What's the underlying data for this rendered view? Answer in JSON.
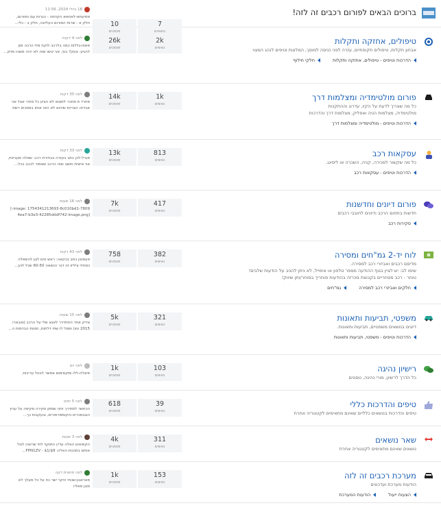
{
  "forums": [
    {
      "id": "welcome",
      "title": "ברוכים הבאים לפורום רכבים זה לזה!",
      "dark": true,
      "icon": "welcome-banner-icon",
      "description": [],
      "links": [],
      "stats": {
        "topics": "7",
        "topics_label": "נושאים",
        "posts": "10",
        "posts_label": "פוסטים"
      },
      "last": {
        "time": "18 ביולי 2024, 11:56",
        "avatar_color": "#c0392b",
        "lines": [
          "פמיעתא-לאתאא הקדמה - הגרות עם הפורום,",
          "חלק א - שרות הפורום העליונה, חלק ב - כלי..."
        ]
      }
    },
    {
      "id": "maintenance",
      "title": "טיפולים, אחזקה ותקלות",
      "icon": "circle-dot-icon",
      "icon_color": "#1a5fb4",
      "description": [
        "אבחון תקלות, טיפולים תקופתיים, עזרה לפני כניסה למוסך, המלצות וטיפים לנהג המצוי"
      ],
      "links": [
        "הדרכות וטיפים - טיפולים, אחזקה ותקלות",
        "חלקי חילוף"
      ],
      "stats": {
        "topics": "2k",
        "topics_label": "נאשים",
        "posts": "26k",
        "posts_label": "פוסטים"
      },
      "last": {
        "time": "לפני 4 דקות",
        "avatar_color": "#2e7d32",
        "lines": [
          "פאוזו-גללות כמה בלרכב לוקח מיזי הרכה זמן",
          "להגיע: צעק? בעי, אני יבשו שזה לא יהיה משהו מזיק..."
        ]
      }
    },
    {
      "id": "multimedia",
      "title": "פורום מולטימדיה ומצלמות דרך",
      "icon": "car-front-icon",
      "icon_color": "#1a1a1a",
      "description": [
        "כל מה שצריך לדעת על הקיו, עדרוג וההתקנות",
        "מולטימדיה, מצלמות הניה ואפליק, מצלמות דרך והדרכות"
      ],
      "links": [
        "הדרכות וטיפים - מולטימדיה ומצלמות דרך"
      ],
      "stats": {
        "topics": "1k",
        "topics_label": "נאשים",
        "posts": "14k",
        "posts_label": "פוסטים"
      },
      "last": {
        "time": "לפני 35 דקות",
        "avatar_color": "#7d7d7d",
        "lines": [
          "פחרד פ מחכר למצוא לא הציע כל מחיר אצל אני",
          "אבדזה הצריות שיהוא לא הזה אותו במסכים רשת"
        ]
      }
    },
    {
      "id": "deals",
      "title": "עסקאות רכב",
      "icon": "car-dealer-icon",
      "icon_color": "#3f51b5",
      "description": [
        "כל מה שקשור למכירה, קניה, השכרה או ליסינג."
      ],
      "links": [
        "הדרכות וטיפים - עסקאות רכב"
      ],
      "stats": {
        "topics": "813",
        "topics_label": "נאשים",
        "posts": "13k",
        "posts_label": "פוסטים"
      },
      "last": {
        "time": "לפני 33 דקות",
        "avatar_color": "#26a69a",
        "lines": [
          "פגרל-לכן כתב בעזרה בבחירת רכב: שאלה מעניינת,",
          "אני אישית חושב שזה הרכב שאמור לבכב בכל..."
        ]
      }
    },
    {
      "id": "discussions",
      "title": "פורום דיונים וחדשנות",
      "icon": "chat-bubbles-icon",
      "icon_color": "#4a3ab8",
      "description": [
        "חדשות בתחום הרכב ודיונים לחובבי רכבים"
      ],
      "links": [
        "סקירות רכב"
      ],
      "stats": {
        "topics": "417",
        "topics_label": "נאשים",
        "posts": "7k",
        "posts_label": "פוסטים"
      },
      "last": {
        "time": "לפני 16 שעות",
        "avatar_color": "#7d7d7d",
        "lines": [
          "image: 1754341213693-8c010bd1-7809-]",
          "[4ea7-b3e3-42285dddf742-image.png"
        ]
      }
    },
    {
      "id": "marketplace",
      "title": "לוח יד-2 גמ\"חים ומסירה",
      "icon": "money-icon",
      "icon_color": "#7cb342",
      "description": [
        "מדיסם רכבים ואביזרי רכב למסירה.",
        "שימו לב: יש לציין בגוף ההודעה מספר טלפון או אימייל, לא ניתן להגיב על הודעות שלבים!",
        "טוחר - רכב מסחריים בקבוצת מכרזה בהודעות סוחריך בסוחר/ותן שיווק!"
      ],
      "links": [
        "חלקים ואביזרי רכב למסירה",
        "גמ\"חים"
      ],
      "stats": {
        "topics": "382",
        "topics_label": "נאשים",
        "posts": "758",
        "posts_label": "פוסטים"
      },
      "last": {
        "time": "לפני 43 דקות",
        "avatar_color": "#7d7d7d",
        "lines": [
          "פעסטון כתב בכקאה: ראש טים לגון להשאלה",
          "כמחיזי ציליזו זה דגר הנשאה 60-50 שכל לנע..."
        ]
      }
    },
    {
      "id": "legal",
      "title": "משפטי, תביעות ותאונות",
      "icon": "car-side-icon",
      "icon_color": "#26a69a",
      "description": [
        "דיונים בנושאים משפטיים, תביעות ותאונות."
      ],
      "links": [
        "הדרכות וטיפים - משפטי, תביעות ותאונות"
      ],
      "stats": {
        "topics": "321",
        "topics_label": "נאשים",
        "posts": "5k",
        "posts_label": "פוסטים"
      },
      "last": {
        "time": "לפני 15 שעות",
        "avatar_color": "#7d7d7d",
        "lines": [
          "צדיק אחד התחדדר לאגא שלי על הרכב (סובארו",
          "xv 2015) ופסל לו שתי דלתות, זמנות הבדמות ה..."
        ]
      }
    },
    {
      "id": "license",
      "title": "רישיון נהיגה",
      "icon": "chat-green-icon",
      "icon_color": "#43a047",
      "description": [
        "כל הדרך לרשיון, מורי נהיגה, טסטים"
      ],
      "links": [],
      "stats": {
        "topics": "103",
        "topics_label": "נאשים",
        "posts": "1k",
        "posts_label": "פוסטים"
      },
      "last": {
        "time": "לפני יום",
        "avatar_color": "#bbbbbb",
        "lines": [
          "פיוגלה-ללו ומקסימום אפשר לבטל עריכות."
        ]
      }
    },
    {
      "id": "tips",
      "title": "טיפים והדרכות כללי",
      "icon": "thumbs-up-icon",
      "icon_color": "#9fa8da",
      "description": [
        "טיפים והדרכות בנושאים כלליים שאינם מתאימים לקטגוריה אחרת"
      ],
      "links": [],
      "stats": {
        "topics": "39",
        "topics_label": "נאשים",
        "posts": "618",
        "posts_label": "פוסטים"
      },
      "last": {
        "time": "לפני 5 ימים",
        "avatar_color": "#7d7d7d",
        "lines": [
          "הכחשר למחירך זחה שמתן סקירה מקיפה על עניין",
          "הגובסכרים והקומפרסורים, ובעקבות כך..."
        ]
      }
    },
    {
      "id": "other",
      "title": "שאר נושאים",
      "icon": "swap-arrows-icon",
      "icon_color": "#e53935",
      "description": [
        "נושאים שאינם מתאימים לקטגוריה אחרת"
      ],
      "links": [],
      "stats": {
        "topics": "311",
        "topics_label": "נאשים",
        "posts": "4k",
        "posts_label": "פוסטים"
      },
      "last": {
        "time": "לפני 3 שעות",
        "avatar_color": "#5d4037",
        "lines": [
          "הקופאים האלה עדיין התוקף לחי שרואה לוגל",
          "אותם בתכנות האלה: $9/$1 - FPN1ZV..."
        ]
      }
    },
    {
      "id": "system",
      "title": "מערכת רכבים זה לזה",
      "icon": "car-black-icon",
      "icon_color": "#222222",
      "description": [
        "הודעות מערכת ועדכונים"
      ],
      "links": [
        "הצעות ייעול",
        "הודעות המערכת"
      ],
      "stats": {
        "topics": "153",
        "topics_label": "נאשים",
        "posts": "1k",
        "posts_label": "פוסטים"
      },
      "last": {
        "time": "לפני מחצית דקה",
        "avatar_color": "#2e7d32",
        "lines": [
          "פאראנון-שכתי היקר ישר כח על כל מעלך לא",
          "מוגן מאליו"
        ]
      }
    }
  ]
}
